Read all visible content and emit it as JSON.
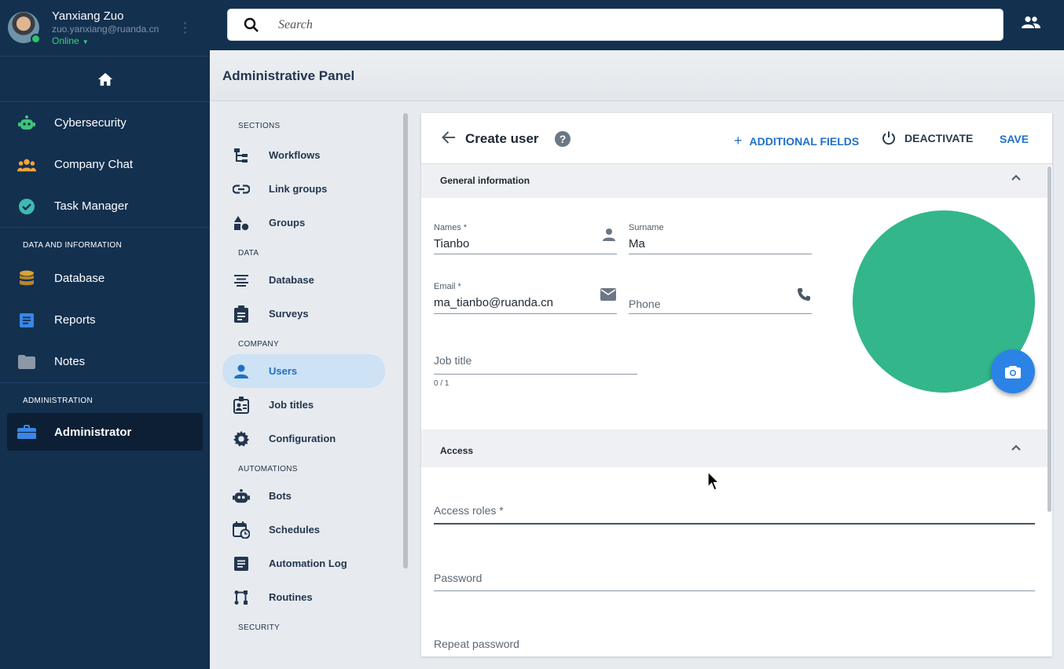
{
  "profile": {
    "name": "Yanxiang Zuo",
    "email": "zuo.yanxiang@ruanda.cn",
    "status": "Online"
  },
  "left_nav": {
    "apps": [
      {
        "label": "Cybersecurity",
        "icon": "robot-icon"
      },
      {
        "label": "Company Chat",
        "icon": "people-icon"
      },
      {
        "label": "Task Manager",
        "icon": "check-circle-icon"
      }
    ],
    "data_heading": "DATA AND INFORMATION",
    "data_items": [
      {
        "label": "Database",
        "icon": "database-icon"
      },
      {
        "label": "Reports",
        "icon": "report-icon"
      },
      {
        "label": "Notes",
        "icon": "folder-icon"
      }
    ],
    "admin_heading": "ADMINISTRATION",
    "admin_item": "Administrator"
  },
  "search": {
    "placeholder": "Search"
  },
  "panel": {
    "title": "Administrative Panel"
  },
  "sections": {
    "h_sections": "SECTIONS",
    "workflows": "Workflows",
    "link_groups": "Link groups",
    "groups": "Groups",
    "h_data": "DATA",
    "database": "Database",
    "surveys": "Surveys",
    "h_company": "COMPANY",
    "users": "Users",
    "job_titles": "Job titles",
    "configuration": "Configuration",
    "h_automations": "AUTOMATIONS",
    "bots": "Bots",
    "schedules": "Schedules",
    "automation_log": "Automation Log",
    "routines": "Routines",
    "h_security": "SECURITY"
  },
  "card": {
    "title": "Create user",
    "additional_fields": "ADDITIONAL FIELDS",
    "deactivate": "DEACTIVATE",
    "save": "SAVE",
    "general_heading": "General information",
    "access_heading": "Access"
  },
  "form": {
    "names_label": "Names *",
    "names_value": "Tianbo",
    "surname_label": "Surname",
    "surname_value": "Ma",
    "email_label": "Email *",
    "email_value": "ma_tianbo@ruanda.cn",
    "phone_placeholder": "Phone",
    "job_placeholder": "Job title",
    "job_counter": "0 / 1",
    "roles_placeholder": "Access roles *",
    "password_placeholder": "Password",
    "repeat_password_placeholder": "Repeat password"
  },
  "colors": {
    "sidebar": "#13304f",
    "accent": "#2070c8",
    "avatar_placeholder": "#33b68b",
    "online": "#2fd86f"
  }
}
